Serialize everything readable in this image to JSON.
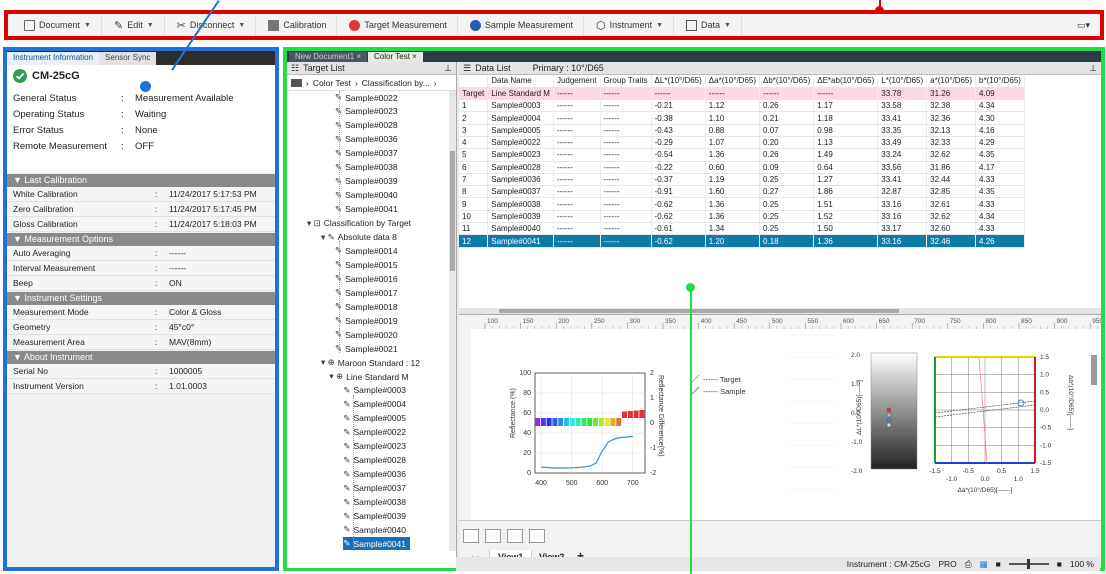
{
  "toolbar": {
    "document": "Document",
    "edit": "Edit",
    "disconnect": "Disconnect",
    "calibration": "Calibration",
    "target_measurement": "Target Measurement",
    "sample_measurement": "Sample Measurement",
    "instrument": "Instrument",
    "data": "Data"
  },
  "left_panel": {
    "tabs": [
      "Instrument Information",
      "Sensor Sync"
    ],
    "device": "CM-25cG",
    "status": [
      {
        "k": "General Status",
        "v": "Measurement Available"
      },
      {
        "k": "Operating Status",
        "v": "Waiting"
      },
      {
        "k": "Error Status",
        "v": "None"
      },
      {
        "k": "Remote Measurement",
        "v": "OFF"
      }
    ],
    "sections": [
      {
        "title": "Last Calibration",
        "rows": [
          {
            "k": "White Calibration",
            "v": "11/24/2017 5:17:53 PM"
          },
          {
            "k": "Zero Calibration",
            "v": "11/24/2017 5:17:45 PM"
          },
          {
            "k": "Gloss Calibration",
            "v": "11/24/2017 5:18:03 PM"
          }
        ]
      },
      {
        "title": "Measurement Options",
        "rows": [
          {
            "k": "Auto Averaging",
            "v": "------"
          },
          {
            "k": "Interval Measurement",
            "v": "------"
          },
          {
            "k": "Beep",
            "v": "ON"
          }
        ]
      },
      {
        "title": "Instrument Settings",
        "rows": [
          {
            "k": "Measurement Mode",
            "v": "Color & Gloss"
          },
          {
            "k": "Geometry",
            "v": "45°c0°"
          },
          {
            "k": "Measurement Area",
            "v": "MAV(8mm)"
          }
        ]
      },
      {
        "title": "About Instrument",
        "rows": [
          {
            "k": "Serial No",
            "v": "1000005"
          },
          {
            "k": "Instrument Version",
            "v": "1.01.0003"
          }
        ]
      }
    ]
  },
  "doc_tabs": [
    "New Document1",
    "Color Test"
  ],
  "target_list": {
    "title": "Target List",
    "breadcrumb": [
      "Color Test",
      "Classification by..."
    ],
    "nodes": [
      {
        "label": "Sample#0022",
        "depth": 3
      },
      {
        "label": "Sample#0023",
        "depth": 3
      },
      {
        "label": "Sample#0028",
        "depth": 3
      },
      {
        "label": "Sample#0036",
        "depth": 3
      },
      {
        "label": "Sample#0037",
        "depth": 3
      },
      {
        "label": "Sample#0038",
        "depth": 3
      },
      {
        "label": "Sample#0039",
        "depth": 3
      },
      {
        "label": "Sample#0040",
        "depth": 3
      },
      {
        "label": "Sample#0041",
        "depth": 3
      },
      {
        "label": "Classification by Target",
        "depth": 1,
        "kind": "folder"
      },
      {
        "label": "Absolute data 8",
        "depth": 2,
        "kind": "abs"
      },
      {
        "label": "Sample#0014",
        "depth": 3
      },
      {
        "label": "Sample#0015",
        "depth": 3
      },
      {
        "label": "Sample#0016",
        "depth": 3
      },
      {
        "label": "Sample#0017",
        "depth": 3
      },
      {
        "label": "Sample#0018",
        "depth": 3
      },
      {
        "label": "Sample#0019",
        "depth": 3
      },
      {
        "label": "Sample#0020",
        "depth": 3
      },
      {
        "label": "Sample#0021",
        "depth": 3
      },
      {
        "label": "Maroon Standard : 12",
        "depth": 2,
        "kind": "std"
      },
      {
        "label": "Line Standard M",
        "depth": 2.6,
        "kind": "std"
      },
      {
        "label": "Sample#0003",
        "depth": 3.6
      },
      {
        "label": "Sample#0004",
        "depth": 3.6
      },
      {
        "label": "Sample#0005",
        "depth": 3.6
      },
      {
        "label": "Sample#0022",
        "depth": 3.6
      },
      {
        "label": "Sample#0023",
        "depth": 3.6
      },
      {
        "label": "Sample#0028",
        "depth": 3.6
      },
      {
        "label": "Sample#0036",
        "depth": 3.6
      },
      {
        "label": "Sample#0037",
        "depth": 3.6
      },
      {
        "label": "Sample#0038",
        "depth": 3.6
      },
      {
        "label": "Sample#0039",
        "depth": 3.6
      },
      {
        "label": "Sample#0040",
        "depth": 3.6
      },
      {
        "label": "Sample#0041",
        "depth": 3.6,
        "selected": true
      }
    ]
  },
  "data_list": {
    "title": "Data List",
    "primary": "Primary : 10°/D65",
    "columns": [
      "",
      "Data Name",
      "Judgement",
      "Group Traits",
      "ΔL*(10°/D65)",
      "Δa*(10°/D65)",
      "Δb*(10°/D65)",
      "ΔE*ab(10°/D65)",
      "L*(10°/D65)",
      "a*(10°/D65)",
      "b*(10°/D65)"
    ],
    "rows": [
      [
        "Target",
        "Line Standard M",
        "------",
        "------",
        "------",
        "------",
        "------",
        "------",
        "33.78",
        "31.26",
        "4.09"
      ],
      [
        "1",
        "Sample#0003",
        "------",
        "------",
        "-0.21",
        "1.12",
        "0.26",
        "1.17",
        "33.58",
        "32.38",
        "4.34"
      ],
      [
        "2",
        "Sample#0004",
        "------",
        "------",
        "-0.38",
        "1.10",
        "0.21",
        "1.18",
        "33.41",
        "32.36",
        "4.30"
      ],
      [
        "3",
        "Sample#0005",
        "------",
        "------",
        "-0.43",
        "0.88",
        "0.07",
        "0.98",
        "33.35",
        "32.13",
        "4.16"
      ],
      [
        "4",
        "Sample#0022",
        "------",
        "------",
        "-0.29",
        "1.07",
        "0.20",
        "1.13",
        "33.49",
        "32.33",
        "4.29"
      ],
      [
        "5",
        "Sample#0023",
        "------",
        "------",
        "-0.54",
        "1.36",
        "0.26",
        "1.49",
        "33.24",
        "32.62",
        "4.35"
      ],
      [
        "6",
        "Sample#0028",
        "------",
        "------",
        "-0.22",
        "0.60",
        "0.09",
        "0.64",
        "33.56",
        "31.86",
        "4.17"
      ],
      [
        "7",
        "Sample#0036",
        "------",
        "------",
        "-0.37",
        "1.19",
        "0.25",
        "1.27",
        "33.41",
        "32.44",
        "4.33"
      ],
      [
        "8",
        "Sample#0037",
        "------",
        "------",
        "-0.91",
        "1.60",
        "0.27",
        "1.86",
        "32.87",
        "32.85",
        "4.35"
      ],
      [
        "9",
        "Sample#0038",
        "------",
        "------",
        "-0.62",
        "1.36",
        "0.25",
        "1.51",
        "33.16",
        "32.61",
        "4.33"
      ],
      [
        "10",
        "Sample#0039",
        "------",
        "------",
        "-0.62",
        "1.36",
        "0.25",
        "1.52",
        "33.16",
        "32.62",
        "4.34"
      ],
      [
        "11",
        "Sample#0040",
        "------",
        "------",
        "-0.61",
        "1.34",
        "0.25",
        "1.50",
        "33.17",
        "32.60",
        "4.33"
      ],
      [
        "12",
        "Sample#0041",
        "------",
        "------",
        "-0.62",
        "1.20",
        "0.18",
        "1.36",
        "33.16",
        "32.46",
        "4.26"
      ]
    ]
  },
  "ruler_ticks": [
    "100",
    "150",
    "200",
    "250",
    "300",
    "350",
    "400",
    "450",
    "500",
    "550",
    "600",
    "650",
    "700",
    "750",
    "800",
    "850",
    "900",
    "950"
  ],
  "chart_data": [
    {
      "type": "line",
      "ylabel": "Reflectance (%)",
      "y2label": "Reflectance Difference(%)",
      "x": [
        400,
        420,
        440,
        460,
        480,
        500,
        520,
        540,
        560,
        580,
        600,
        620,
        640,
        660,
        680,
        700
      ],
      "yticks": [
        "100",
        "80",
        "60",
        "40",
        "20",
        "0"
      ],
      "y2ticks": [
        "2",
        "1",
        "0",
        "-1",
        "-2"
      ],
      "xticks": [
        "400",
        "500",
        "600",
        "700"
      ],
      "ylim": [
        0,
        100
      ],
      "xlim": [
        380,
        740
      ],
      "series": [
        {
          "name": "Sample",
          "values": [
            6,
            5.5,
            5,
            5,
            5,
            5.2,
            5.5,
            6,
            7,
            10,
            22,
            31,
            34,
            35.5,
            36,
            36.5
          ]
        }
      ],
      "legend": [
        "------ Target",
        "------ Sample"
      ]
    },
    {
      "type": "scatter",
      "ylabel": "ΔL*(10°/D65)[------]",
      "yticks": [
        "2.0",
        "1.0",
        "0.0",
        "-1.0",
        "-2.0"
      ]
    },
    {
      "type": "scatter",
      "xlabel": "Δa*(10°/D65)[------]",
      "ylabel": "Δb*(10°/D65)[------]",
      "xticks": [
        "-1.5",
        "-1.0",
        "-0.5",
        "0.0",
        "0.5",
        "1.0",
        "1.5"
      ],
      "yticks": [
        "1.5",
        "1.0",
        "0.5",
        "0.0",
        "-0.5",
        "-1.0",
        "-1.5"
      ]
    }
  ],
  "views": {
    "tabs": [
      "View1",
      "View2"
    ],
    "add": "+"
  },
  "status": {
    "instrument": "Instrument : CM-25cG",
    "mode": "PRO",
    "zoom": "100 %"
  },
  "colors": {
    "callout_red": "#e00000",
    "callout_blue": "#1e73d8",
    "callout_green": "#22dd44",
    "selection": "#0e7aa8"
  }
}
